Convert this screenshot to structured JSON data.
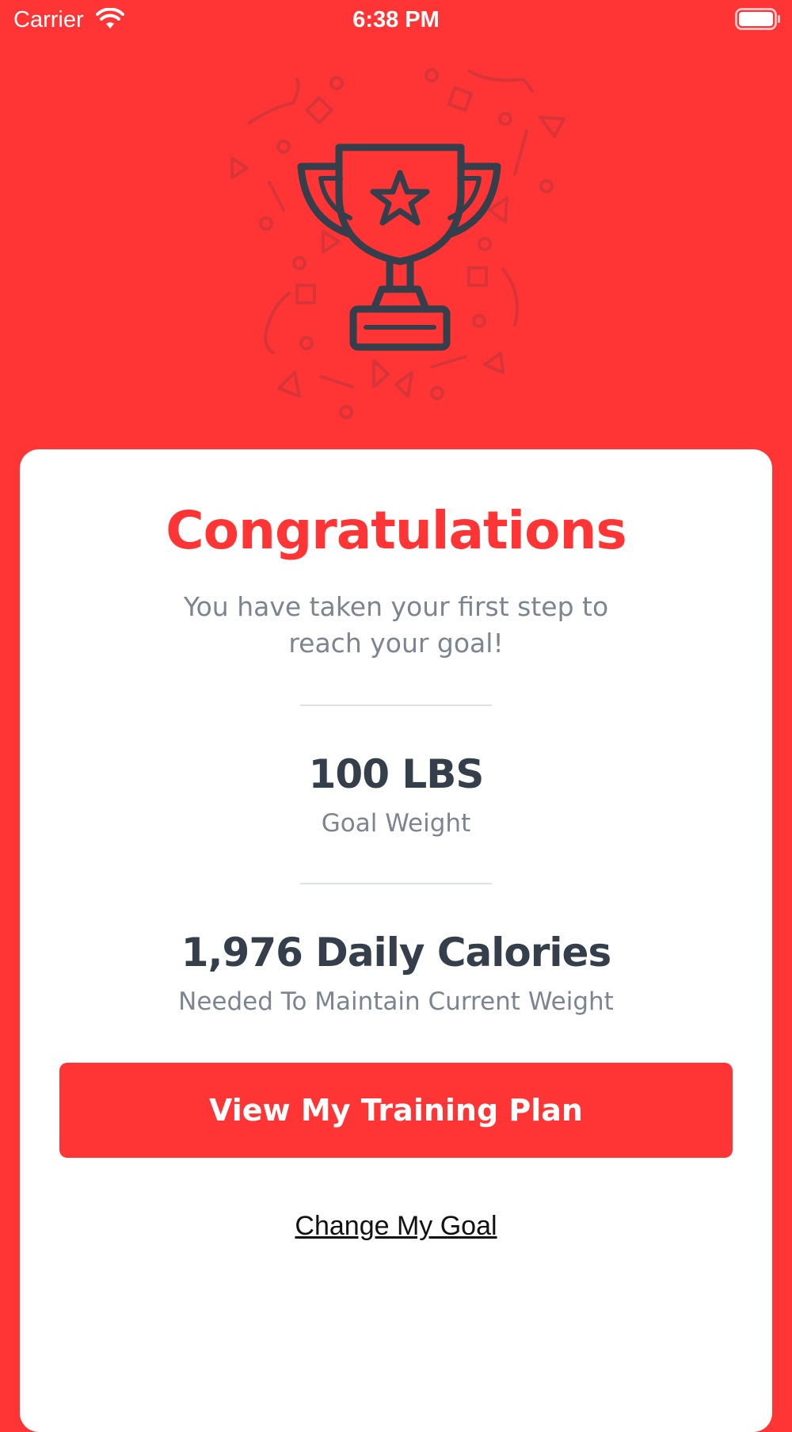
{
  "status_bar": {
    "carrier": "Carrier",
    "time": "6:38 PM",
    "wifi_icon": "wifi-icon",
    "battery_icon": "battery-full-icon"
  },
  "hero": {
    "icon": "trophy-icon",
    "decoration": "confetti"
  },
  "card": {
    "title": "Congratulations",
    "subtitle": "You have taken your first step to reach your goal!",
    "goal_weight": {
      "value": "100 LBS",
      "label": "Goal Weight"
    },
    "calories": {
      "value": "1,976 Daily Calories",
      "label": "Needed To Maintain Current Weight"
    },
    "primary_button_label": "View My Training Plan",
    "secondary_link_label": "Change My Goal"
  },
  "colors": {
    "accent": "#FE3435",
    "card_background": "#FFFFFF",
    "dark_text": "#343F4B",
    "muted_text": "#7C858F",
    "divider": "#DDE1E5"
  }
}
